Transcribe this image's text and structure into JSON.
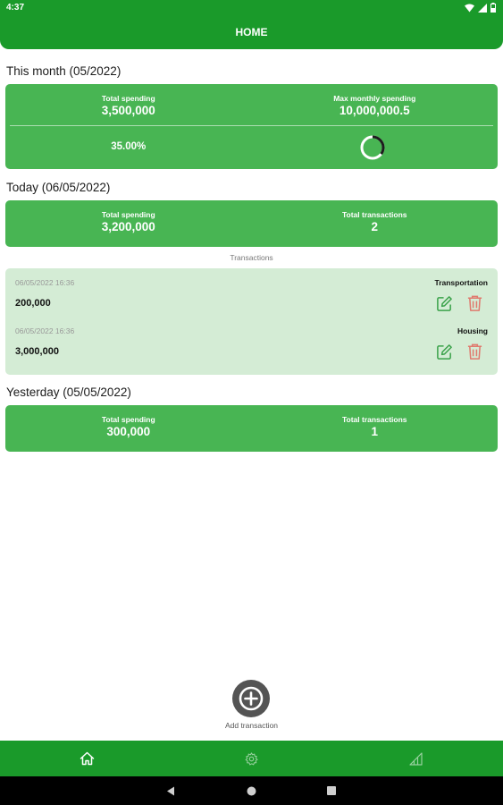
{
  "status_bar": {
    "time": "4:37"
  },
  "header": {
    "title": "HOME"
  },
  "this_month": {
    "heading": "This month (05/2022)",
    "total_spending_label": "Total spending",
    "total_spending_value": "3,500,000",
    "max_spending_label": "Max monthly spending",
    "max_spending_value": "10,000,000.5",
    "percent_text": "35.00%",
    "progress_fraction": 0.35
  },
  "today": {
    "heading": "Today (06/05/2022)",
    "total_spending_label": "Total spending",
    "total_spending_value": "3,200,000",
    "total_transactions_label": "Total transactions",
    "total_transactions_value": "2"
  },
  "transactions": {
    "caption": "Transactions",
    "items": [
      {
        "datetime": "06/05/2022 16:36",
        "amount": "200,000",
        "category": "Transportation"
      },
      {
        "datetime": "06/05/2022 16:36",
        "amount": "3,000,000",
        "category": "Housing"
      }
    ]
  },
  "yesterday": {
    "heading": "Yesterday (05/05/2022)",
    "total_spending_label": "Total spending",
    "total_spending_value": "300,000",
    "total_transactions_label": "Total transactions",
    "total_transactions_value": "1"
  },
  "add_transaction": {
    "label": "Add transaction",
    "icon": "plus-circle-icon"
  },
  "bottom_nav": [
    {
      "icon": "home-icon",
      "active": true
    },
    {
      "icon": "gear-icon",
      "active": false
    },
    {
      "icon": "stats-icon",
      "active": false
    }
  ],
  "colors": {
    "primary": "#1a9a2a",
    "card": "#48b553",
    "panel": "#d4ecd5",
    "edit": "#3aa24a",
    "delete": "#e07a6e"
  }
}
